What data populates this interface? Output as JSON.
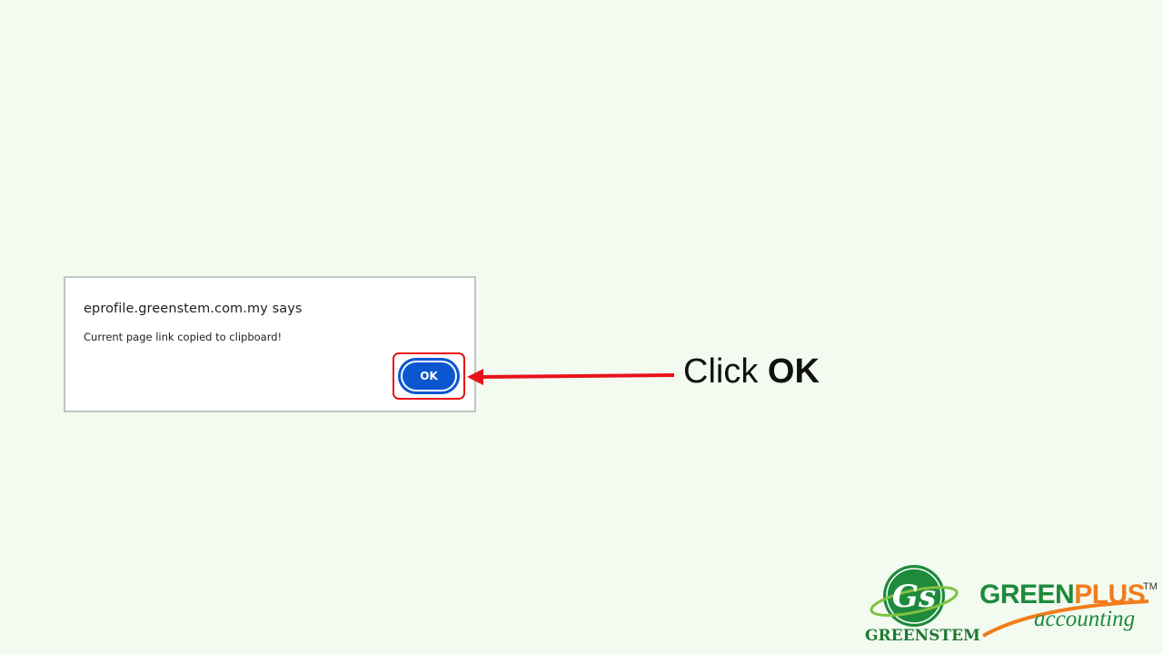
{
  "dialog": {
    "title": "eprofile.greenstem.com.my says",
    "message": "Current page link copied to clipboard!",
    "ok_label": "OK"
  },
  "instruction": {
    "prefix": "Click ",
    "emphasis": "OK"
  },
  "logos": {
    "greenstem_initials": "GS",
    "greenstem_name": "GREENSTEM",
    "greenplus_part1": "GREEN",
    "greenplus_part2": "PLUS",
    "trademark": "TM",
    "greenplus_sub": "accounting"
  },
  "colors": {
    "background": "#f3faf0",
    "highlight": "#e8121b",
    "button": "#0b57d0",
    "brand_green": "#1e8a3c",
    "brand_orange": "#f07d1a"
  }
}
